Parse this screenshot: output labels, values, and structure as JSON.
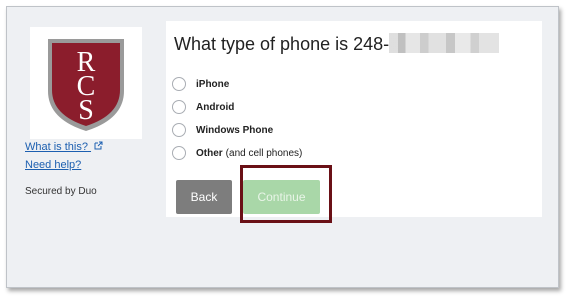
{
  "sidebar": {
    "logo_letters": [
      "R",
      "C",
      "S"
    ],
    "what_is_this": "What is this?",
    "need_help": "Need help?",
    "secured_by": "Secured by Duo"
  },
  "prompt": {
    "question_prefix": "What type of phone is 248-"
  },
  "options": [
    {
      "label": "iPhone",
      "sub": ""
    },
    {
      "label": "Android",
      "sub": ""
    },
    {
      "label": "Windows Phone",
      "sub": ""
    },
    {
      "label": "Other",
      "sub": "(and cell phones)"
    }
  ],
  "buttons": {
    "back": "Back",
    "continue": "Continue"
  },
  "colors": {
    "shield": "#8b1d2c",
    "link": "#1c5fb0",
    "highlight": "#6a1016",
    "continue_bg": "#a9d7a8"
  }
}
